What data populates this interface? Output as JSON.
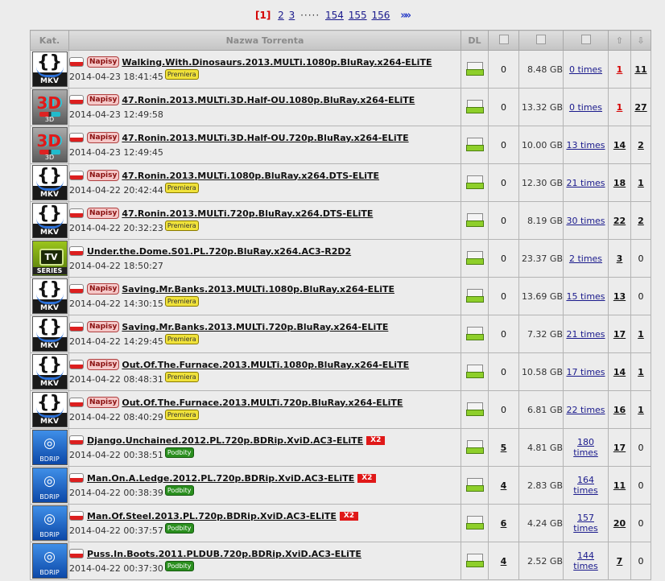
{
  "pager": {
    "current": "[1]",
    "pages": [
      "2",
      "3"
    ],
    "dots": "·····",
    "tail_pages": [
      "154",
      "155",
      "156"
    ],
    "next": "»»"
  },
  "headers": {
    "kat": "Kat.",
    "name": "Nazwa Torrenta",
    "dl": "DL"
  },
  "labels": {
    "napisy": "Napisy",
    "premiera": "Premiera",
    "podbity": "Podbity",
    "x2": "X2"
  },
  "rows": [
    {
      "cat": "MKV",
      "napisy": true,
      "name": "Walking.With.Dinosaurs.2013.MULTi.1080p.BluRay.x264-ELiTE",
      "date": "2014-04-23 18:41:45",
      "badge": "premiera",
      "x2": false,
      "comments": "0",
      "comments_u": false,
      "size": "8.48 GB",
      "times": "0 times",
      "seeds": "1",
      "seeds_red": true,
      "leech": "11",
      "leech_b": true
    },
    {
      "cat": "3D",
      "napisy": true,
      "name": "47.Ronin.2013.MULTi.3D.Half-OU.1080p.BluRay.x264-ELiTE",
      "date": "2014-04-23 12:49:58",
      "badge": "",
      "x2": false,
      "comments": "0",
      "comments_u": false,
      "size": "13.32 GB",
      "times": "0 times",
      "seeds": "1",
      "seeds_red": true,
      "leech": "27",
      "leech_b": true
    },
    {
      "cat": "3D",
      "napisy": true,
      "name": "47.Ronin.2013.MULTi.3D.Half-OU.720p.BluRay.x264-ELiTE",
      "date": "2014-04-23 12:49:45",
      "badge": "",
      "x2": false,
      "comments": "0",
      "comments_u": false,
      "size": "10.00 GB",
      "times": "13 times",
      "seeds": "14",
      "seeds_red": false,
      "leech": "2",
      "leech_b": true
    },
    {
      "cat": "MKV",
      "napisy": true,
      "name": "47.Ronin.2013.MULTi.1080p.BluRay.x264.DTS-ELiTE",
      "date": "2014-04-22 20:42:44",
      "badge": "premiera",
      "x2": false,
      "comments": "0",
      "comments_u": false,
      "size": "12.30 GB",
      "times": "21 times",
      "seeds": "18",
      "seeds_red": false,
      "leech": "1",
      "leech_b": true
    },
    {
      "cat": "MKV",
      "napisy": true,
      "name": "47.Ronin.2013.MULTi.720p.BluRay.x264.DTS-ELiTE",
      "date": "2014-04-22 20:32:23",
      "badge": "premiera",
      "x2": false,
      "comments": "0",
      "comments_u": false,
      "size": "8.19 GB",
      "times": "30 times",
      "seeds": "22",
      "seeds_red": false,
      "leech": "2",
      "leech_b": true
    },
    {
      "cat": "TV",
      "napisy": false,
      "name": "Under.the.Dome.S01.PL.720p.BluRay.x264.AC3-R2D2",
      "date": "2014-04-22 18:50:27",
      "badge": "",
      "x2": false,
      "comments": "0",
      "comments_u": false,
      "size": "23.37 GB",
      "times": "2 times",
      "seeds": "3",
      "seeds_red": false,
      "leech": "0",
      "leech_b": false
    },
    {
      "cat": "MKV",
      "napisy": true,
      "name": "Saving.Mr.Banks.2013.MULTi.1080p.BluRay.x264-ELiTE",
      "date": "2014-04-22 14:30:15",
      "badge": "premiera",
      "x2": false,
      "comments": "0",
      "comments_u": false,
      "size": "13.69 GB",
      "times": "15 times",
      "seeds": "13",
      "seeds_red": false,
      "leech": "0",
      "leech_b": false
    },
    {
      "cat": "MKV",
      "napisy": true,
      "name": "Saving.Mr.Banks.2013.MULTi.720p.BluRay.x264-ELiTE",
      "date": "2014-04-22 14:29:45",
      "badge": "premiera",
      "x2": false,
      "comments": "0",
      "comments_u": false,
      "size": "7.32 GB",
      "times": "21 times",
      "seeds": "17",
      "seeds_red": false,
      "leech": "1",
      "leech_b": true
    },
    {
      "cat": "MKV",
      "napisy": true,
      "name": "Out.Of.The.Furnace.2013.MULTi.1080p.BluRay.x264-ELiTE",
      "date": "2014-04-22 08:48:31",
      "badge": "premiera",
      "x2": false,
      "comments": "0",
      "comments_u": false,
      "size": "10.58 GB",
      "times": "17 times",
      "seeds": "14",
      "seeds_red": false,
      "leech": "1",
      "leech_b": true
    },
    {
      "cat": "MKV",
      "napisy": true,
      "name": "Out.Of.The.Furnace.2013.MULTi.720p.BluRay.x264-ELiTE",
      "date": "2014-04-22 08:40:29",
      "badge": "premiera",
      "x2": false,
      "comments": "0",
      "comments_u": false,
      "size": "6.81 GB",
      "times": "22 times",
      "seeds": "16",
      "seeds_red": false,
      "leech": "1",
      "leech_b": true
    },
    {
      "cat": "BD",
      "napisy": false,
      "name": "Django.Unchained.2012.PL.720p.BDRip.XviD.AC3-ELiTE",
      "date": "2014-04-22 00:38:51",
      "badge": "podbity",
      "x2": true,
      "comments": "5",
      "comments_u": true,
      "size": "4.81 GB",
      "times": "180 times",
      "seeds": "17",
      "seeds_red": false,
      "leech": "0",
      "leech_b": false
    },
    {
      "cat": "BD",
      "napisy": false,
      "name": "Man.On.A.Ledge.2012.PL.720p.BDRip.XviD.AC3-ELiTE",
      "date": "2014-04-22 00:38:39",
      "badge": "podbity",
      "x2": true,
      "comments": "4",
      "comments_u": true,
      "size": "2.83 GB",
      "times": "164 times",
      "seeds": "11",
      "seeds_red": false,
      "leech": "0",
      "leech_b": false
    },
    {
      "cat": "BD",
      "napisy": false,
      "name": "Man.Of.Steel.2013.PL.720p.BDRip.XviD.AC3-ELiTE",
      "date": "2014-04-22 00:37:57",
      "badge": "podbity",
      "x2": true,
      "comments": "6",
      "comments_u": true,
      "size": "4.24 GB",
      "times": "157 times",
      "seeds": "20",
      "seeds_red": false,
      "leech": "0",
      "leech_b": false
    },
    {
      "cat": "BD",
      "napisy": false,
      "name": "Puss.In.Boots.2011.PLDUB.720p.BDRip.XviD.AC3-ELiTE",
      "date": "2014-04-22 00:37:30",
      "badge": "podbity",
      "x2": false,
      "comments": "4",
      "comments_u": true,
      "size": "2.52 GB",
      "times": "144 times",
      "seeds": "7",
      "seeds_red": false,
      "leech": "0",
      "leech_b": false
    }
  ]
}
